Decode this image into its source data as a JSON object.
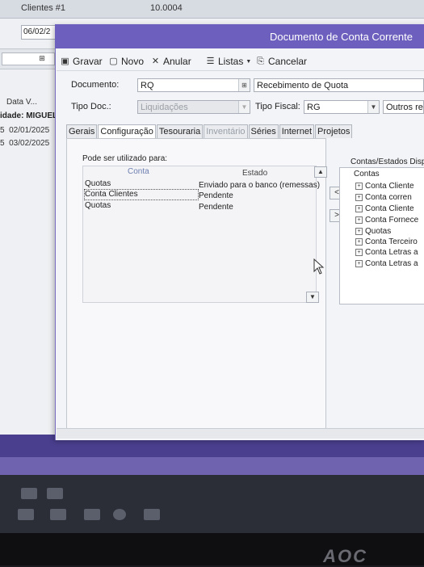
{
  "background": {
    "top_label_clients": "Clientes #1",
    "top_label_value": "10.0004",
    "date_field": "06/02/2",
    "column_header": "Data V...",
    "entity_label": "idade: MIGUEL",
    "rows": [
      {
        "marker": "5",
        "date": "02/01/2025"
      },
      {
        "marker": "5",
        "date": "03/02/2025"
      }
    ]
  },
  "dialog": {
    "title": "Documento de Conta Corrente",
    "toolbar": {
      "save": "Gravar",
      "new": "Novo",
      "cancel_doc": "Anular",
      "lists": "Listas",
      "cancel": "Cancelar"
    },
    "form": {
      "documento_label": "Documento:",
      "documento_value": "RQ",
      "documento_desc": "Recebimento de Quota",
      "tipo_doc_label": "Tipo Doc.:",
      "tipo_doc_value": "Liquidações",
      "tipo_fiscal_label": "Tipo Fiscal:",
      "tipo_fiscal_value": "RG",
      "tipo_fiscal_other": "Outros rec"
    },
    "tabs": [
      "Gerais",
      "Configuração",
      "Tesouraria",
      "Inventário",
      "Séries",
      "Internet",
      "Projetos"
    ],
    "active_tab": "Configuração",
    "config": {
      "usage_label": "Pode ser utilizado para:",
      "col_conta": "Conta",
      "col_estado": "Estado",
      "rows": [
        {
          "conta": "Quotas",
          "estado": "Enviado para o banco (remessas)"
        },
        {
          "conta": "Conta Clientes",
          "estado": "Pendente"
        },
        {
          "conta": "Quotas",
          "estado": "Pendente"
        }
      ],
      "btn_remove": "<",
      "btn_add": ">"
    },
    "tree": {
      "header": "Contas/Estados Disp",
      "root": "Contas",
      "items": [
        "Conta Cliente",
        "Conta corren",
        "Conta Cliente",
        "Conta Fornece",
        "Quotas",
        "Conta Terceiro",
        "Conta Letras a",
        "Conta Letras a"
      ]
    }
  },
  "monitor_brand": "AOC"
}
